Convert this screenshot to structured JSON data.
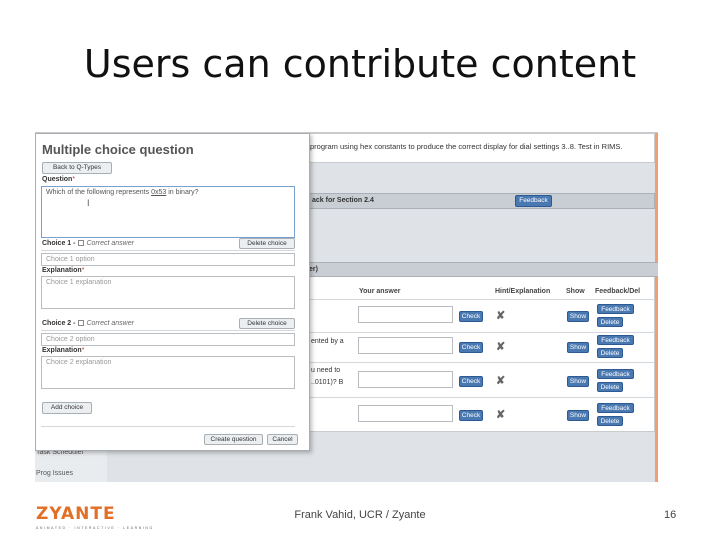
{
  "slide": {
    "title": "Users can contribute content",
    "footer": "Frank Vahid, UCR / Zyante",
    "page_number": "16",
    "logo": "ZYANTE",
    "logo_tagline": "ANIMATED · INTERACTIVE · LEARNING"
  },
  "dialog": {
    "title": "Multiple choice question",
    "back_button": "Back to Q-Types",
    "question_label": "Question",
    "question_value_prefix": "Which of the following represents",
    "question_value_hex": "0x53",
    "question_value_suffix": "in binary?",
    "choice1_label": "Choice 1 -",
    "choice2_label": "Choice 2 -",
    "correct_answer_label": "Correct answer",
    "delete_choice": "Delete choice",
    "choice1_placeholder": "Choice 1 option",
    "choice2_placeholder": "Choice 2 option",
    "explanation_label": "Explanation",
    "explanation1_placeholder": "Choice 1 explanation",
    "explanation2_placeholder": "Choice 2 explanation",
    "add_choice": "Add choice",
    "create_question": "Create question",
    "cancel": "Cancel",
    "required_mark": "*"
  },
  "background": {
    "prompt_text": "program using hex constants to produce the correct display for dial settings 3..8. Test in RIMS.",
    "section_bar": "ack for Section 2.4",
    "feedback_top": "Feedback",
    "table_bar": "er)",
    "columns": [
      "Your answer",
      "Hint/Explanation",
      "Show",
      "Feedback/Del"
    ],
    "row_texts": [
      "ented by a",
      "u need to",
      "..0101)? B"
    ],
    "check": "Check",
    "show": "Show",
    "feedback": "Feedback",
    "delete": "Delete",
    "xmark": "✘",
    "nav_items": [
      "Task Scheduler",
      "Prog Issues"
    ]
  }
}
